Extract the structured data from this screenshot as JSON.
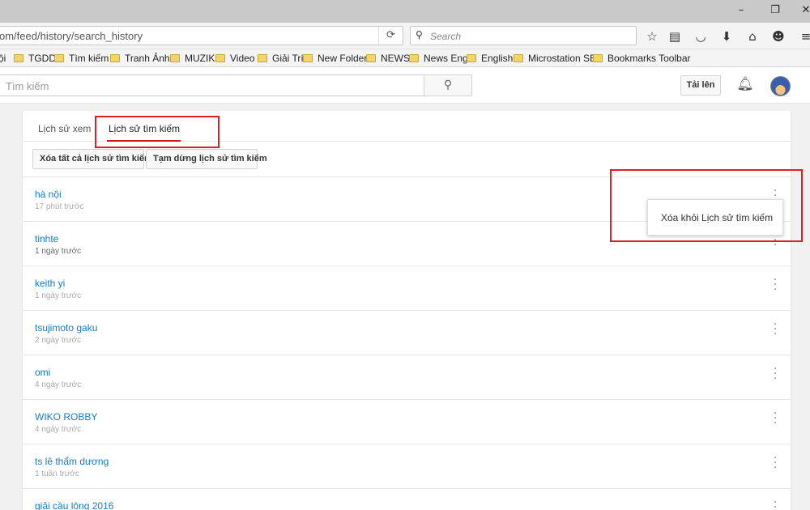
{
  "browser": {
    "url": "om/feed/history/search_history",
    "search_placeholder": "Search",
    "window_buttons": [
      "–",
      "❐",
      "✕"
    ]
  },
  "bookmarks": [
    "ội",
    "TGDD",
    "Tìm kiếm",
    "Tranh Ảnh",
    "MUZIK",
    "Video",
    "Giải Trí",
    "New Folder",
    "NEWS",
    "News Eng",
    "English",
    "Microstation SE",
    "Bookmarks Toolbar"
  ],
  "header": {
    "search_placeholder": "Tìm kiếm",
    "upload_label": "Tải lên"
  },
  "tabs": [
    {
      "label": "Lịch sử xem"
    },
    {
      "label": "Lịch sử tìm kiếm"
    }
  ],
  "actions": {
    "clear_all": "Xóa tất cả lịch sử tìm kiếm",
    "pause": "Tạm dừng lịch sử tìm kiếm"
  },
  "history": [
    {
      "query": "hà nội",
      "time": "17 phút trước"
    },
    {
      "query": "tinhte",
      "time": "1 ngày trước"
    },
    {
      "query": "keith yi",
      "time": "1 ngày trước"
    },
    {
      "query": "tsujimoto gaku",
      "time": "2 ngày trước"
    },
    {
      "query": "omi",
      "time": "4 ngày trước"
    },
    {
      "query": "WIKO ROBBY",
      "time": "4 ngày trước"
    },
    {
      "query": "ts lê thẩm dương",
      "time": "1 tuần trước"
    },
    {
      "query": "giải cầu lông 2016",
      "time": ""
    }
  ],
  "context_menu": {
    "remove_label": "Xóa khỏi Lịch sử tìm kiếm"
  },
  "colors": {
    "link": "#167ac6",
    "highlight": "#e02020",
    "tab_underline": "#cc181e"
  }
}
